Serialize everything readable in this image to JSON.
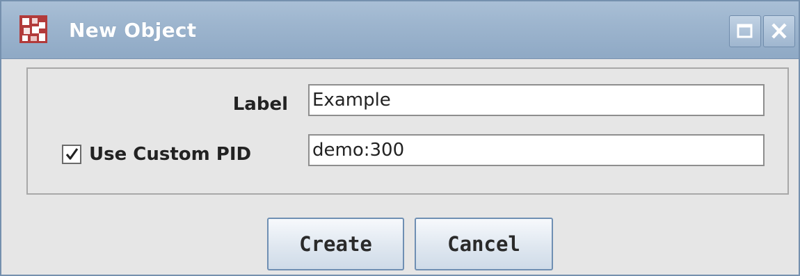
{
  "window": {
    "title": "New Object"
  },
  "titlebar": {
    "icons": [
      "app-icon",
      "maximize-icon",
      "close-icon"
    ]
  },
  "form": {
    "label_caption": "Label",
    "label_value": "Example",
    "custom_pid_caption": "Use Custom PID",
    "custom_pid_checked": true,
    "custom_pid_value": "demo:300"
  },
  "buttons": {
    "create": "Create",
    "cancel": "Cancel"
  },
  "colors": {
    "titlebar": "#9db5ce",
    "background": "#e6e6e6",
    "button_border": "#6f8fb3"
  }
}
